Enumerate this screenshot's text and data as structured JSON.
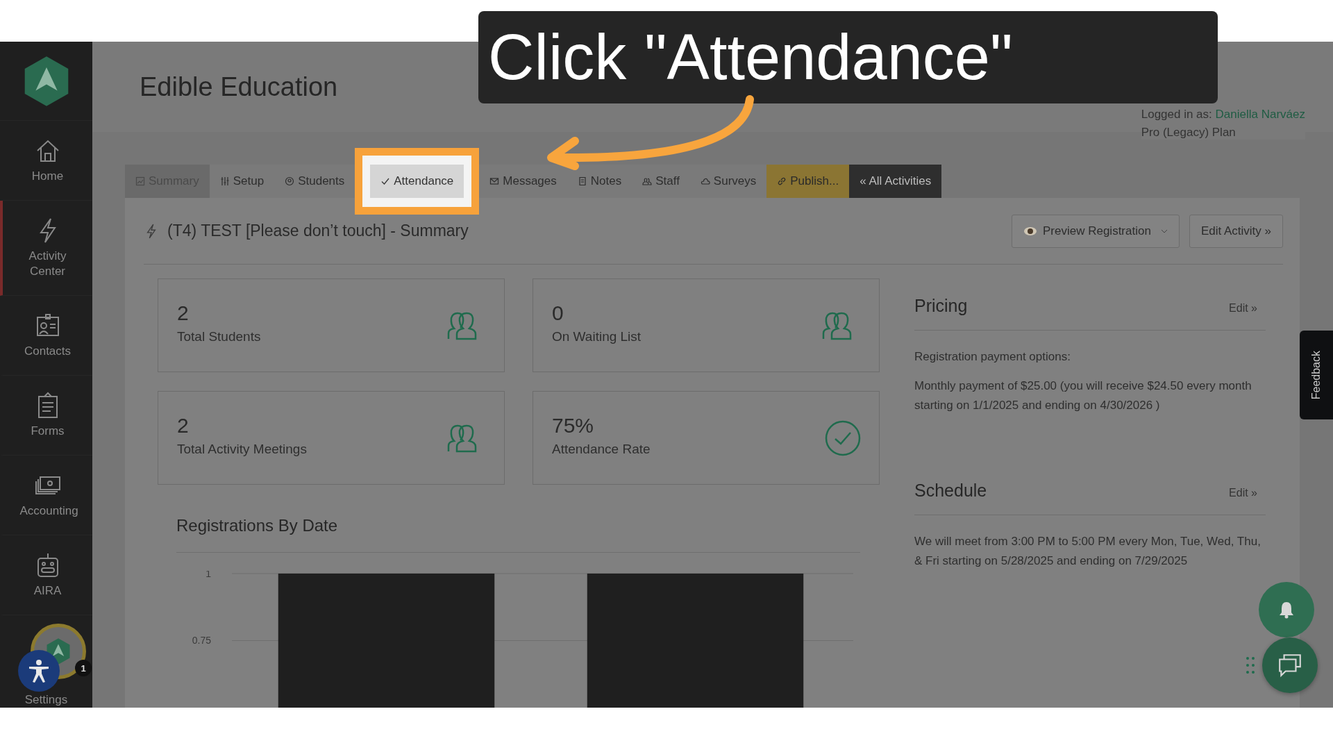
{
  "caption": "Click \"Attendance\"",
  "sidebar": {
    "items": [
      {
        "label": "Home",
        "selected": false
      },
      {
        "label": "Activity Center",
        "selected": true
      },
      {
        "label": "Contacts",
        "selected": false
      },
      {
        "label": "Forms",
        "selected": false
      },
      {
        "label": "Accounting",
        "selected": false
      },
      {
        "label": "AIRA",
        "selected": false
      }
    ],
    "settings_label": "Settings",
    "notification_count": "1"
  },
  "header": {
    "title": "Edible Education",
    "logged_in_label": "Logged in as:",
    "user_name": "Daniella Narváez",
    "plan": "Pro (Legacy) Plan"
  },
  "tabs": [
    {
      "label": "Summary",
      "kind": "tab",
      "selected": true,
      "highlighted": false
    },
    {
      "label": "Setup",
      "kind": "tab",
      "selected": false,
      "highlighted": false
    },
    {
      "label": "Students",
      "kind": "tab",
      "selected": false,
      "highlighted": false
    },
    {
      "label": "Attendance",
      "kind": "tab",
      "selected": false,
      "highlighted": true
    },
    {
      "label": "Messages",
      "kind": "tab",
      "selected": false,
      "highlighted": false
    },
    {
      "label": "Notes",
      "kind": "tab",
      "selected": false,
      "highlighted": false
    },
    {
      "label": "Staff",
      "kind": "tab",
      "selected": false,
      "highlighted": false
    },
    {
      "label": "Surveys",
      "kind": "tab",
      "selected": false,
      "highlighted": false
    },
    {
      "label": "Publish...",
      "kind": "publish",
      "selected": false,
      "highlighted": false
    },
    {
      "label": "« All Activities",
      "kind": "back",
      "selected": false,
      "highlighted": false
    }
  ],
  "activity": {
    "title": "(T4) TEST [Please don’t touch] - Summary",
    "buttons": [
      {
        "label": "Preview Registration",
        "kind": "dropdown"
      },
      {
        "label": "Edit Activity »",
        "kind": "plain"
      }
    ]
  },
  "stats": [
    {
      "value": "2",
      "label": "Total Students",
      "kind": "count"
    },
    {
      "value": "0",
      "label": "On Waiting List",
      "kind": "count"
    },
    {
      "value": "2",
      "label": "Total Activity Meetings",
      "kind": "count"
    },
    {
      "value": "75%",
      "label": "Attendance Rate",
      "kind": "rate"
    }
  ],
  "chart": {
    "title": "Registrations By Date",
    "chart_data": {
      "type": "bar",
      "values": [
        1,
        1
      ],
      "yticks": [
        1,
        0.75
      ],
      "ylim": [
        0.5,
        1
      ]
    }
  },
  "pricing": {
    "title": "Pricing",
    "edit": "Edit »",
    "lines": [
      "Registration payment options:",
      "Monthly payment of $25.00 (you will receive $24.50 every month starting on 1/1/2025 and ending on 4/30/2026 )"
    ]
  },
  "schedule": {
    "title": "Schedule",
    "edit": "Edit »",
    "text": "We will meet from 3:00 PM to 5:00 PM every Mon, Tue, Wed, Thu, & Fri starting on 5/28/2025 and ending on 7/29/2025"
  },
  "feedback": "Feedback"
}
